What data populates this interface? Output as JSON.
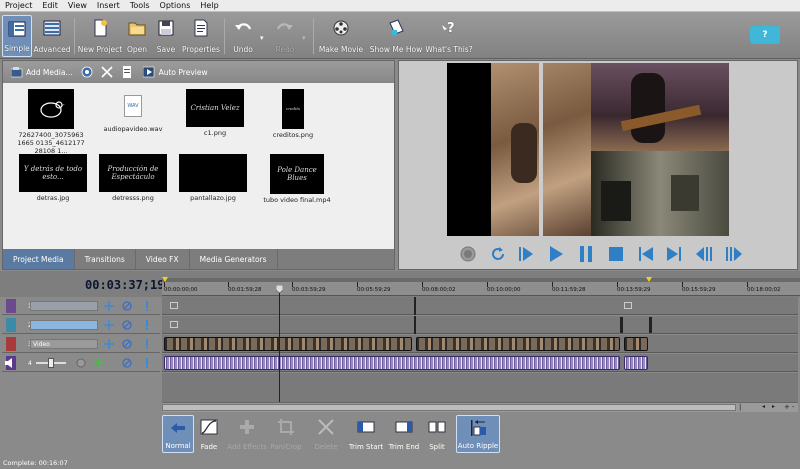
{
  "menu": [
    "Project",
    "Edit",
    "View",
    "Insert",
    "Tools",
    "Options",
    "Help"
  ],
  "toolbar": {
    "simple": "Simple",
    "advanced": "Advanced",
    "new_project": "New Project",
    "open": "Open",
    "save": "Save",
    "properties": "Properties",
    "undo": "Undo",
    "redo": "Redo",
    "make_movie": "Make Movie",
    "show_me_how": "Show Me How",
    "whats_this": "What's This?"
  },
  "help_badge": "?",
  "media_toolbar": {
    "add_media": "Add Media...",
    "auto_preview": "Auto Preview"
  },
  "media_items": [
    {
      "caption": "72627400_30759631665 0135_461217728108 1...",
      "art": "logo"
    },
    {
      "caption": "audiopavideo.wav",
      "art": "WAV"
    },
    {
      "caption": "c1.png",
      "art": "Cristian Velez"
    },
    {
      "caption": "creditos.png",
      "art": "credits"
    },
    {
      "caption": "detras.jpg",
      "art": "Y detrás de todo esto..."
    },
    {
      "caption": "detresss.png",
      "art": "Producción de Espectáculo"
    },
    {
      "caption": "pantallazo.jpg",
      "art": ""
    },
    {
      "caption": "tubo video final.mp4",
      "art": "Pole Dance Blues"
    }
  ],
  "media_tabs": [
    "Project Media",
    "Transitions",
    "Video FX",
    "Media Generators"
  ],
  "timeline": {
    "timecode": "00:03:37;19",
    "ruler": [
      "00:00:00;00",
      "00:01:59;28",
      "00:03:59;29",
      "00:05:59;29",
      "00:08:00;02",
      "00:10:00;00",
      "00:11:59;28",
      "00:13:59;29",
      "00:15:59;29",
      "00:18:00;02"
    ],
    "tracks": [
      {
        "num": "1",
        "name": ""
      },
      {
        "num": "2",
        "name": ""
      },
      {
        "num": "3",
        "name": "Video"
      },
      {
        "num": "4",
        "name": ""
      }
    ]
  },
  "bottom_tools": {
    "normal": "Normal",
    "fade": "Fade",
    "add_effects": "Add Effects",
    "pan_crop": "Pan/Crop",
    "delete": "Delete",
    "trim_start": "Trim Start",
    "trim_end": "Trim End",
    "split": "Split",
    "auto_ripple": "Auto Ripple"
  },
  "status": "Complete: 00:16:07",
  "colors": {
    "accent": "#6f8fb8",
    "help": "#3fb7d9",
    "audio": "#6a5a9a"
  }
}
